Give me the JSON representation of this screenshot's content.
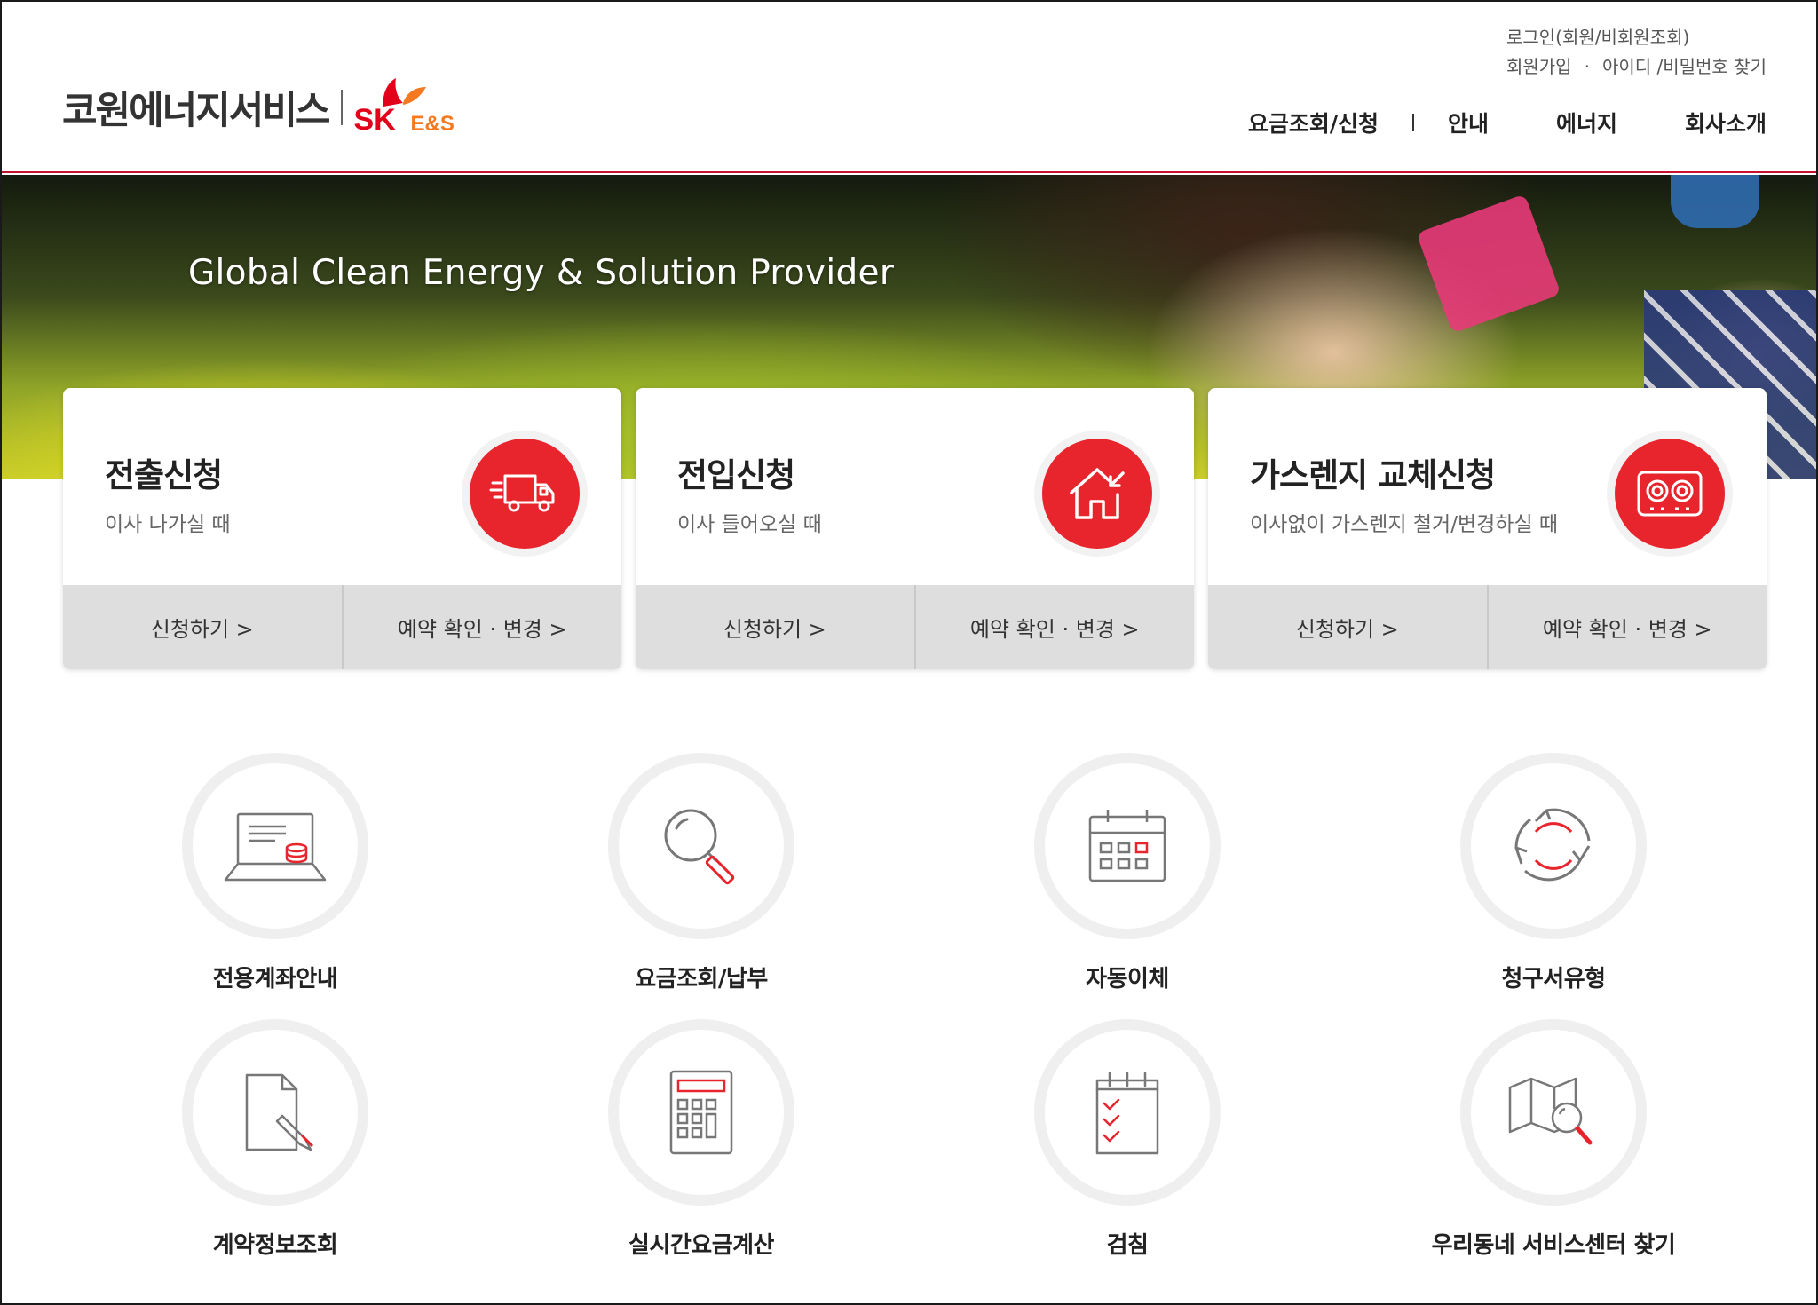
{
  "header": {
    "logo_text": "코원에너지서비스",
    "logo_sk": "SK",
    "logo_es": "E&S",
    "util": {
      "login": "로그인(회원/비회원조회)",
      "signup": "회원가입",
      "find": "아이디 /비밀번호 찾기"
    },
    "nav": [
      "요금조회/신청",
      "안내",
      "에너지",
      "회사소개"
    ]
  },
  "hero": {
    "tagline": "Global Clean Energy & Solution Provider"
  },
  "cards": [
    {
      "title": "전출신청",
      "subtitle": "이사 나가실 때",
      "icon": "moving-truck-icon",
      "apply": "신청하기 >",
      "manage": "예약 확인 · 변경 >"
    },
    {
      "title": "전입신청",
      "subtitle": "이사 들어오실 때",
      "icon": "house-enter-icon",
      "apply": "신청하기 >",
      "manage": "예약 확인 · 변경 >"
    },
    {
      "title": "가스렌지 교체신청",
      "subtitle": "이사없이 가스렌지 철거/변경하실 때",
      "icon": "gas-range-icon",
      "apply": "신청하기 >",
      "manage": "예약 확인 · 변경 >"
    }
  ],
  "quick_menu": [
    {
      "label": "전용계좌안내",
      "icon": "laptop-coins-icon"
    },
    {
      "label": "요금조회/납부",
      "icon": "magnifier-icon"
    },
    {
      "label": "자동이체",
      "icon": "calendar-icon"
    },
    {
      "label": "청구서유형",
      "icon": "recycle-arrows-icon"
    },
    {
      "label": "계약정보조회",
      "icon": "document-pen-icon"
    },
    {
      "label": "실시간요금계산",
      "icon": "calculator-icon"
    },
    {
      "label": "검침",
      "icon": "checklist-icon"
    },
    {
      "label": "우리동네 서비스센터 찾기",
      "icon": "map-search-icon"
    }
  ],
  "colors": {
    "accent": "#e8242c",
    "brand_red": "#e3001b",
    "brand_orange": "#f47920"
  }
}
